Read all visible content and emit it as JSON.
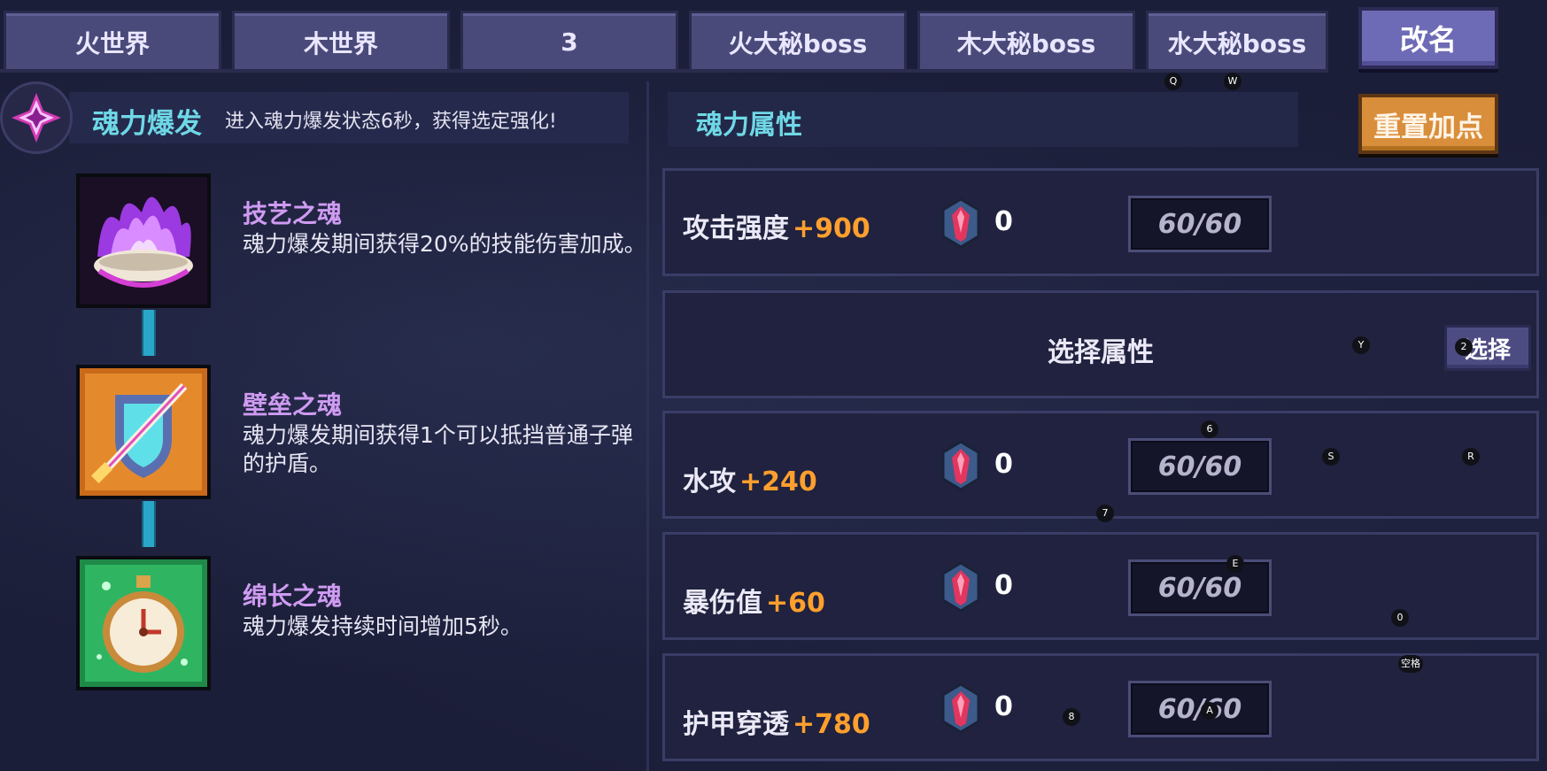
{
  "tabs": [
    {
      "label": "火世界"
    },
    {
      "label": "木世界"
    },
    {
      "label": "3"
    },
    {
      "label": "火大秘boss"
    },
    {
      "label": "木大秘boss"
    },
    {
      "label": "水大秘boss"
    }
  ],
  "rename_label": "改名",
  "burst": {
    "title": "魂力爆发",
    "description": "进入魂力爆发状态6秒，获得选定强化!"
  },
  "souls": [
    {
      "name": "技艺之魂",
      "description": "魂力爆发期间获得20%的技能伤害加成。",
      "icon": "purple-flame-bowl-icon"
    },
    {
      "name": "壁垒之魂",
      "description": "魂力爆发期间获得1个可以抵挡普通子弹的护盾。",
      "icon": "shield-sword-icon"
    },
    {
      "name": "绵长之魂",
      "description": "魂力爆发持续时间增加5秒。",
      "icon": "stopwatch-icon"
    }
  ],
  "attributes": {
    "title": "魂力属性",
    "reset_label": "重置加点",
    "rows": [
      {
        "label": "攻击强度",
        "bonus": "+900",
        "count": "0",
        "cap": "60/60"
      },
      {
        "label": "水攻",
        "bonus": "+240",
        "count": "0",
        "cap": "60/60"
      },
      {
        "label": "暴伤值",
        "bonus": "+60",
        "count": "0",
        "cap": "60/60"
      },
      {
        "label": "护甲穿透",
        "bonus": "+780",
        "count": "0",
        "cap": "60/60"
      }
    ],
    "select_row": {
      "label": "选择属性",
      "button": "选择"
    }
  },
  "key_hints": [
    "Q",
    "W",
    "2",
    "Y",
    "6",
    "S",
    "R",
    "7",
    "E",
    "0",
    "空格",
    "8",
    "A"
  ],
  "colors": {
    "tab_bg": "#4a4a7a",
    "accent_cyan": "#6fd8e6",
    "soul_name": "#cf9bf2",
    "bonus_orange": "#ff9f2e",
    "reset_orange": "#d98e3c"
  }
}
